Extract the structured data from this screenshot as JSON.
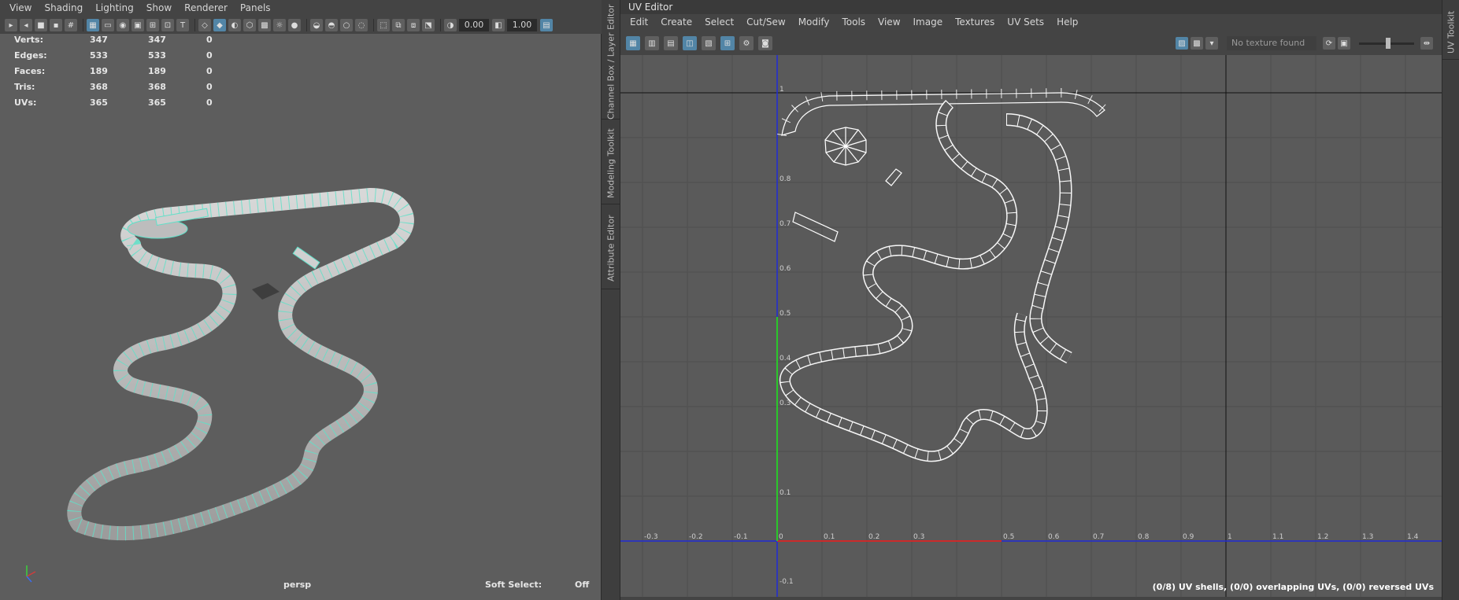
{
  "left_viewport": {
    "menu": [
      "View",
      "Shading",
      "Lighting",
      "Show",
      "Renderer",
      "Panels"
    ],
    "toolbar": {
      "field1": "0.00",
      "field2": "1.00"
    },
    "hud": [
      {
        "label": "Verts:",
        "v1": "347",
        "v2": "347",
        "v3": "0"
      },
      {
        "label": "Edges:",
        "v1": "533",
        "v2": "533",
        "v3": "0"
      },
      {
        "label": "Faces:",
        "v1": "189",
        "v2": "189",
        "v3": "0"
      },
      {
        "label": "Tris:",
        "v1": "368",
        "v2": "368",
        "v3": "0"
      },
      {
        "label": "UVs:",
        "v1": "365",
        "v2": "365",
        "v3": "0"
      }
    ],
    "camera_label": "persp",
    "soft_select_label": "Soft Select:",
    "soft_select_value": "Off",
    "axis_labels": {
      "x": "X",
      "y": "Y",
      "z": "Z"
    }
  },
  "side_tabs": [
    "Channel Box / Layer Editor",
    "Modeling Toolkit",
    "Attribute Editor"
  ],
  "right_tab": "UV Toolkit",
  "uv_editor": {
    "title": "UV Editor",
    "menu": [
      "Edit",
      "Create",
      "Select",
      "Cut/Sew",
      "Modify",
      "Tools",
      "View",
      "Image",
      "Textures",
      "UV Sets",
      "Help"
    ],
    "texture_field": "No texture found",
    "x_ticks": [
      "-0.3",
      "-0.2",
      "-0.1",
      "0",
      "0.1",
      "0.2",
      "0.3",
      "0.5",
      "0.6",
      "0.7",
      "0.8",
      "0.9",
      "1",
      "1.1",
      "1.2",
      "1.3",
      "1.4"
    ],
    "y_ticks": [
      "1",
      "0.8",
      "0.7",
      "0.6",
      "0.5",
      "0.4",
      "0.3",
      "0.1",
      "-0.1"
    ],
    "status": "(0/8) UV shells, (0/0) overlapping UVs, (0/0) reversed UVs",
    "colors": {
      "grid": "#4f4f4f",
      "shell": "#ffffff",
      "u_axis": "#cc2a2a",
      "v_axis": "#2ac72a",
      "frame": "#1f2bd6"
    }
  }
}
